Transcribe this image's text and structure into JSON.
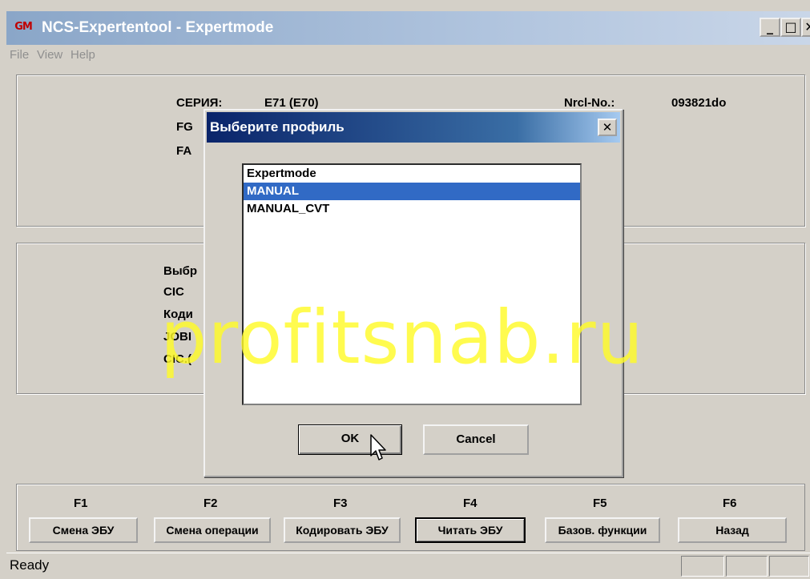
{
  "window": {
    "title": "NCS-Expertentool - Expertmode",
    "icon_text": "GM",
    "controls": {
      "minimize": "_",
      "maximize": "□",
      "close": "✕"
    }
  },
  "menu": {
    "file": "File",
    "view": "View",
    "help": "Help"
  },
  "vehicle_panel": {
    "series_label": "СЕРИЯ:",
    "series_value": "E71 (E70)",
    "fg_label": "FG",
    "fa_label": "FA",
    "nrcl_label": "Nrcl-No.:",
    "nrcl_value": "093821do"
  },
  "ecu_panel": {
    "line1": "Выбр",
    "line2": "CIC",
    "line3": "Коди",
    "line4": "JOBI",
    "line5": "CIC.("
  },
  "dialog": {
    "title": "Выберите профиль",
    "close": "✕",
    "items": [
      "Expertmode",
      "MANUAL",
      "MANUAL_CVT"
    ],
    "selected_index": 1,
    "ok": "OK",
    "cancel": "Cancel"
  },
  "function_keys": [
    {
      "key": "F1",
      "label": "Смена ЭБУ"
    },
    {
      "key": "F2",
      "label": "Смена операции"
    },
    {
      "key": "F3",
      "label": "Кодировать ЭБУ"
    },
    {
      "key": "F4",
      "label": "Читать ЭБУ"
    },
    {
      "key": "F5",
      "label": "Базов. функции"
    },
    {
      "key": "F6",
      "label": "Назад"
    }
  ],
  "status": {
    "text": "Ready"
  },
  "watermark": "profitsnab.ru"
}
